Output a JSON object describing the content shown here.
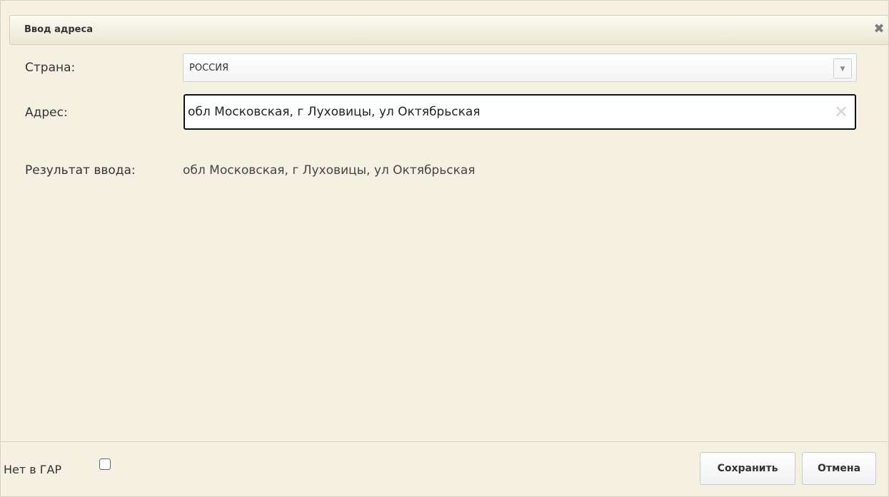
{
  "dialog": {
    "title": "Ввод адреса",
    "close_icon": "close-icon"
  },
  "country": {
    "label": "Страна:",
    "value": "РОССИЯ",
    "dropdown_icon": "triangle-down-icon"
  },
  "address": {
    "label": "Адрес:",
    "value": "обл Московская, г Луховицы, ул Октябрьская",
    "clear_icon": "clear-icon"
  },
  "result": {
    "label": "Результат ввода:",
    "value": "обл Московская, г Луховицы, ул Октябрьская"
  },
  "footer": {
    "no_gar_label": "Нет в ГАР",
    "no_gar_checked": false,
    "save_label": "Сохранить",
    "cancel_label": "Отмена"
  }
}
